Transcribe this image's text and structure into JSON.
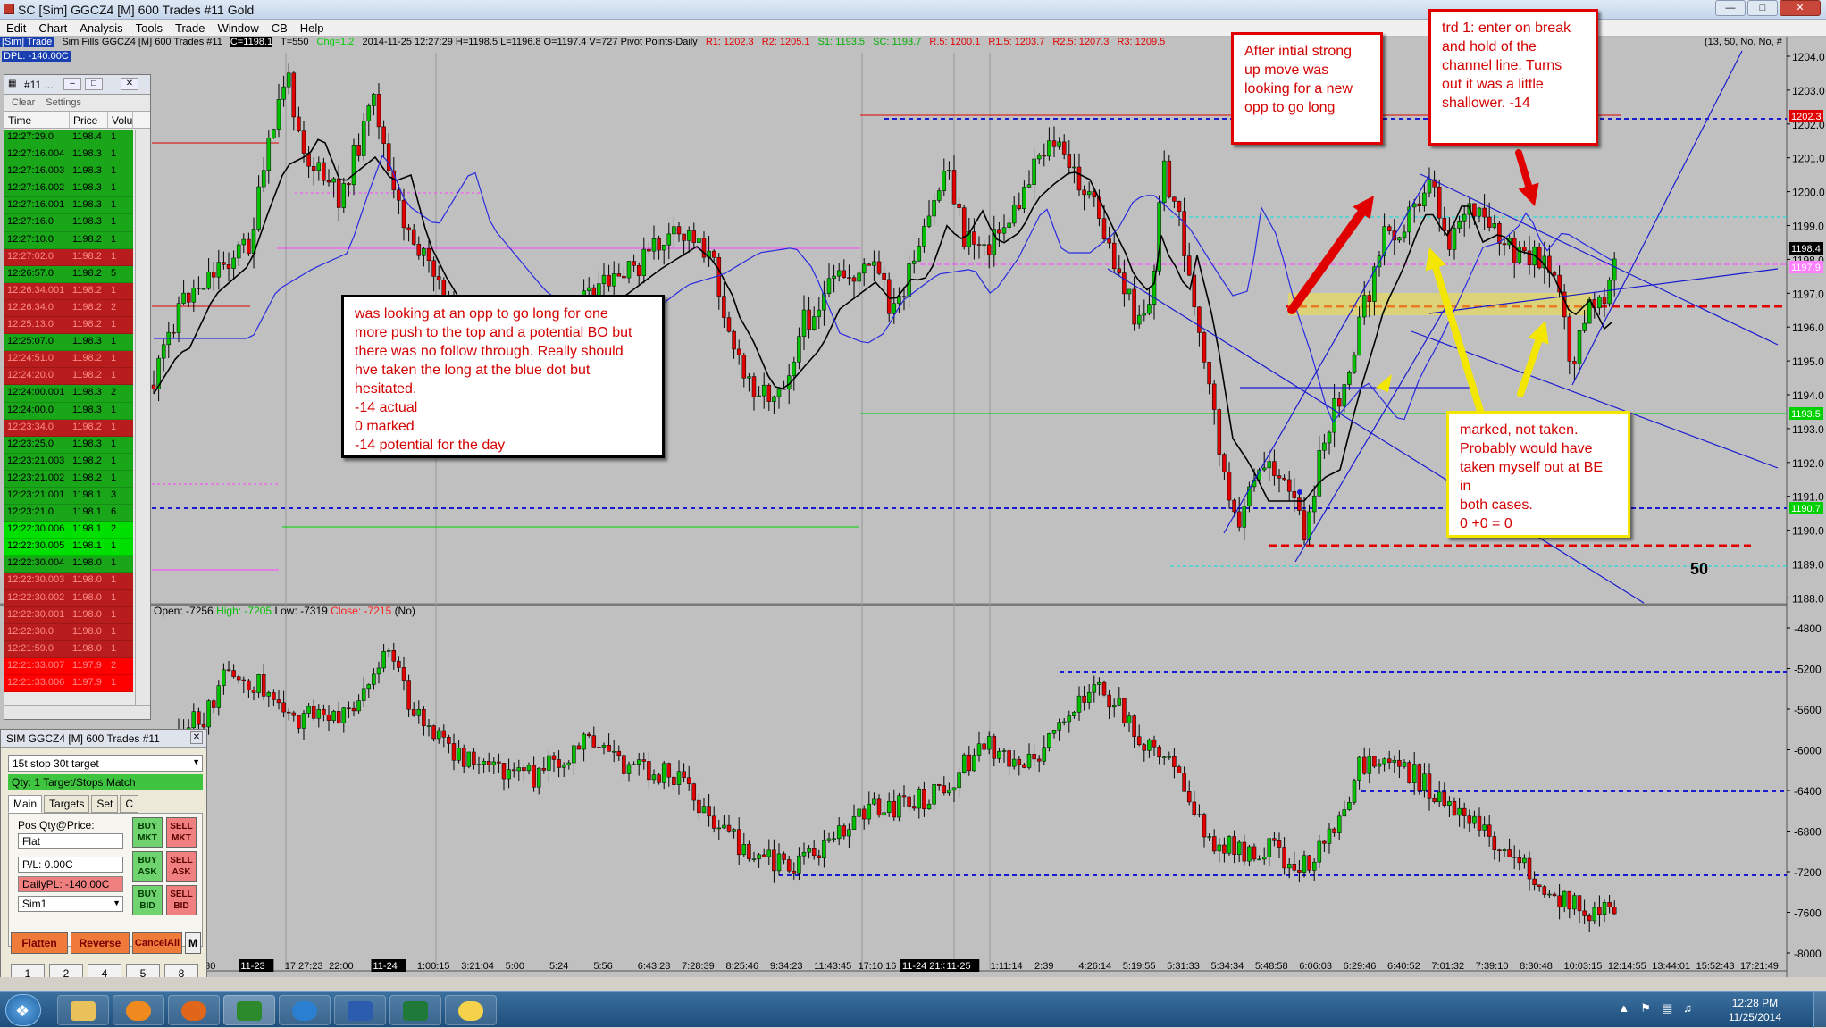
{
  "window": {
    "title": "SC [Sim] GGCZ4 [M] 600 Trades #11 Gold",
    "minimize_icon": "minimize-icon",
    "maximize_icon": "maximize-icon",
    "close_icon": "close-icon"
  },
  "menu": [
    "Edit",
    "Chart",
    "Analysis",
    "Tools",
    "Trade",
    "Window",
    "CB",
    "Help"
  ],
  "infobar": {
    "sim": "[Sim] Trade",
    "symbol": "Sim Fills GGCZ4 [M] 600 Trades #11",
    "last": "C=1198.1",
    "ticks": "T=550",
    "chg": "Chg=1.2",
    "bar": "2014-11-25 12:27:29 H=1198.5 L=1196.8 O=1197.4 V=727 Pivot Points-Daily",
    "r1": "R1: 1202.3",
    "r2": "R2: 1205.1",
    "s1": "S1: 1193.5",
    "sc": "SC: 1193.7",
    "r5": "R.5: 1200.1",
    "r15": "R1.5: 1203.7",
    "r25": "R2.5: 1207.3",
    "r3": "R3: 1209.5",
    "tail": "(13, 50, No, No, #",
    "dpl": "DPL: -140.00C"
  },
  "price_axis": {
    "labels": [
      "1204.0",
      "1203.0",
      "1202.0",
      "1201.0",
      "1200.0",
      "1199.0",
      "1198.0",
      "1197.0",
      "1196.0",
      "1195.0",
      "1194.0",
      "1193.0",
      "1192.0",
      "1191.0",
      "1190.0",
      "1189.0",
      "1188.0"
    ],
    "current": "1198.4",
    "r1_tag": "1202.3",
    "green_tag": "1193.5",
    "green_tag2": "1190.7",
    "magenta_tag": "1197.9"
  },
  "delta_axis": {
    "labels": [
      "-4800",
      "-5200",
      "-5600",
      "-6000",
      "-6400",
      "-6800",
      "-7200",
      "-7600",
      "-8000"
    ]
  },
  "panel2": {
    "open": "Open: -7256",
    "high": "High: -7205",
    "low": "Low: -7319",
    "close": "Close: -7215",
    "no": "(No)"
  },
  "time_axis": [
    "0:30",
    "11-23",
    "17:27:23",
    "22:00",
    "11-24",
    "1:00:15",
    "3:21:04",
    "5:00",
    "5:24",
    "5:56",
    "6:43:28",
    "7:28:39",
    "8:25:46",
    "9:34:23",
    "11:43:45",
    "17:10:16",
    "11-24 21:31",
    "11-25",
    "1:11:14",
    "2:39",
    "4:26:14",
    "5:19:55",
    "5:31:33",
    "5:34:34",
    "5:48:58",
    "6:06:03",
    "6:29:46",
    "6:40:52",
    "7:01:32",
    "7:39:10",
    "8:30:48",
    "10:03:15",
    "12:14:55",
    "13:44:01",
    "15:52:43",
    "17:21:49"
  ],
  "annotations": {
    "black_box": "was looking at an opp to go long for one\nmore push to the top and a potential BO but\nthere was no follow through.  Really should\nhve taken the long at the blue dot but\nhesitated.\n-14 actual\n0 marked\n-14 potential for the day",
    "red_box_1": "After intial strong\nup move was\nlooking for a new\nopp to go long",
    "red_box_2": "trd 1: enter on break\nand hold of the\nchannel line.  Turns\nout it was a little\nshallower. -14",
    "yellow_box": "marked, not taken.\nProbably would have\ntaken myself out at BE in\nboth cases.\n0 +0 = 0",
    "ma_period": "50"
  },
  "time_sales": {
    "title": "#11 ...",
    "clear": "Clear",
    "settings": "Settings",
    "headers": [
      "Time",
      "Price",
      "Volu"
    ],
    "rows": [
      {
        "time": "12:27:29.0",
        "price": "1198.4",
        "vol": "1",
        "c": "g"
      },
      {
        "time": "12:27:16.004",
        "price": "1198.3",
        "vol": "1",
        "c": "g"
      },
      {
        "time": "12:27:16.003",
        "price": "1198.3",
        "vol": "1",
        "c": "g"
      },
      {
        "time": "12:27:16.002",
        "price": "1198.3",
        "vol": "1",
        "c": "g"
      },
      {
        "time": "12:27:16.001",
        "price": "1198.3",
        "vol": "1",
        "c": "g"
      },
      {
        "time": "12:27:16.0",
        "price": "1198.3",
        "vol": "1",
        "c": "g"
      },
      {
        "time": "12:27:10.0",
        "price": "1198.2",
        "vol": "1",
        "c": "g"
      },
      {
        "time": "12:27:02.0",
        "price": "1198.2",
        "vol": "1",
        "c": "r"
      },
      {
        "time": "12:26:57.0",
        "price": "1198.2",
        "vol": "5",
        "c": "g"
      },
      {
        "time": "12:26:34.001",
        "price": "1198.2",
        "vol": "1",
        "c": "r"
      },
      {
        "time": "12:26:34.0",
        "price": "1198.2",
        "vol": "2",
        "c": "r"
      },
      {
        "time": "12:25:13.0",
        "price": "1198.2",
        "vol": "1",
        "c": "r"
      },
      {
        "time": "12:25:07.0",
        "price": "1198.3",
        "vol": "1",
        "c": "g"
      },
      {
        "time": "12:24:51.0",
        "price": "1198.2",
        "vol": "1",
        "c": "r"
      },
      {
        "time": "12:24:20.0",
        "price": "1198.2",
        "vol": "1",
        "c": "r"
      },
      {
        "time": "12:24:00.001",
        "price": "1198.3",
        "vol": "2",
        "c": "g"
      },
      {
        "time": "12:24:00.0",
        "price": "1198.3",
        "vol": "1",
        "c": "g"
      },
      {
        "time": "12:23:34.0",
        "price": "1198.2",
        "vol": "1",
        "c": "r"
      },
      {
        "time": "12:23:25.0",
        "price": "1198.3",
        "vol": "1",
        "c": "g"
      },
      {
        "time": "12:23:21.003",
        "price": "1198.2",
        "vol": "1",
        "c": "g"
      },
      {
        "time": "12:23:21.002",
        "price": "1198.2",
        "vol": "1",
        "c": "g"
      },
      {
        "time": "12:23:21.001",
        "price": "1198.1",
        "vol": "3",
        "c": "g"
      },
      {
        "time": "12:23:21.0",
        "price": "1198.1",
        "vol": "6",
        "c": "g"
      },
      {
        "time": "12:22:30.006",
        "price": "1198.1",
        "vol": "2",
        "c": "lg"
      },
      {
        "time": "12:22:30.005",
        "price": "1198.1",
        "vol": "1",
        "c": "lg"
      },
      {
        "time": "12:22:30.004",
        "price": "1198.0",
        "vol": "1",
        "c": "g"
      },
      {
        "time": "12:22:30.003",
        "price": "1198.0",
        "vol": "1",
        "c": "r"
      },
      {
        "time": "12:22:30.002",
        "price": "1198.0",
        "vol": "1",
        "c": "r"
      },
      {
        "time": "12:22:30.001",
        "price": "1198.0",
        "vol": "1",
        "c": "r"
      },
      {
        "time": "12:22:30.0",
        "price": "1198.0",
        "vol": "1",
        "c": "r"
      },
      {
        "time": "12:21:59.0",
        "price": "1198.0",
        "vol": "1",
        "c": "r"
      },
      {
        "time": "12:21:33.007",
        "price": "1197.9",
        "vol": "2",
        "c": "br"
      },
      {
        "time": "12:21:33.006",
        "price": "1197.9",
        "vol": "1",
        "c": "br"
      }
    ]
  },
  "trade_window": {
    "title": "SIM GGCZ4 [M] 600 Trades #11",
    "strategy": "15t stop 30t target",
    "status": "Qty: 1 Target/Stops Match",
    "tabs": [
      "Main",
      "Targets",
      "Set",
      "C"
    ],
    "pos_label": "Pos Qty@Price:",
    "pos_value": "Flat",
    "pl": "P/L: 0.00C",
    "daily_pl": "DailyPL: -140.00C",
    "account": "Sim1",
    "buy_mkt": "BUY MKT",
    "sell_mkt": "SELL MKT",
    "buy_ask": "BUY ASK",
    "sell_ask": "SELL ASK",
    "buy_bid": "BUY BID",
    "sell_bid": "SELL BID",
    "flatten": "Flatten",
    "reverse": "Reverse",
    "cancel_all": "CancelAll",
    "m": "M",
    "qty_buttons": [
      "1",
      "2",
      "4",
      "5",
      "8"
    ]
  },
  "taskbar": {
    "apps": [
      "explorer",
      "media-player",
      "firefox",
      "sierra-chart",
      "globe",
      "word",
      "excel",
      "notes"
    ],
    "clock_time": "12:28 PM",
    "clock_date": "11/25/2014"
  },
  "colors": {
    "chart_bg": "#c0c0c0",
    "up": "#00c000",
    "down": "#e00000",
    "annotation_red": "#e00000",
    "annotation_yellow": "#f3e600"
  }
}
